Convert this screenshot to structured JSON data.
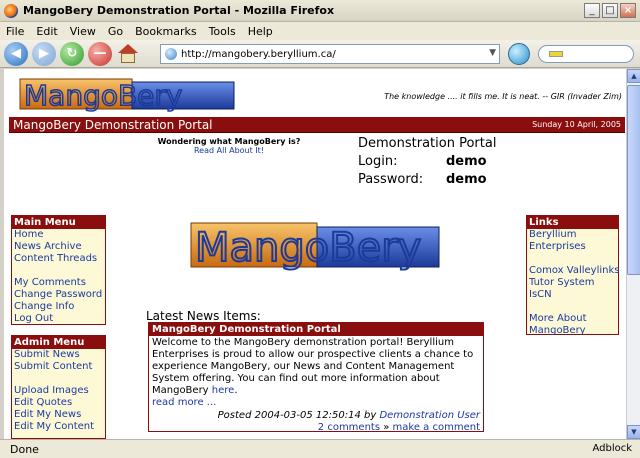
{
  "window": {
    "title": "MangoBery Demonstration Portal - Mozilla Firefox",
    "buttons": [
      "_",
      "□",
      "×"
    ]
  },
  "menu": [
    "File",
    "Edit",
    "View",
    "Go",
    "Bookmarks",
    "Tools",
    "Help"
  ],
  "navigation": {
    "url": "http://mangobery.beryllium.ca/"
  },
  "status": {
    "left": "Done",
    "right": "Adblock"
  },
  "page": {
    "logo_text": "MangoBery",
    "quote": "The knowledge .... it fills me. It is neat. -- GIR (Invader Zim)",
    "banner_title": "MangoBery Demonstration Portal",
    "banner_date": "Sunday 10 April, 2005",
    "wonder": {
      "question": "Wondering what MangoBery is?",
      "link": "Read All About It!"
    },
    "demo": {
      "title": "Demonstration Portal",
      "login_label": "Login:",
      "login_value": "demo",
      "password_label": "Password:",
      "password_value": "demo"
    },
    "main_menu": {
      "heading": "Main Menu",
      "group1": [
        "Home",
        "News Archive",
        "Content Threads"
      ],
      "group2": [
        "My Comments",
        "Change Password",
        "Change Info",
        "Log Out"
      ]
    },
    "admin_menu": {
      "heading": "Admin Menu",
      "group1": [
        "Submit News",
        "Submit Content"
      ],
      "group2": [
        "Upload Images",
        "Edit Quotes",
        "Edit My News",
        "Edit My Content"
      ]
    },
    "links": {
      "heading": "Links",
      "group1": [
        "Beryllium",
        "Enterprises"
      ],
      "group2": [
        "Comox Valleylinks",
        "Tutor System",
        "IsCN"
      ],
      "group3": [
        "More About",
        "MangoBery"
      ]
    },
    "news": {
      "heading": "Latest News Items:",
      "title": "MangoBery Demonstration Portal",
      "body": "Welcome to the MangoBery demonstration portal! Beryllium Enterprises is proud to allow our prospective clients a chance to experience MangoBery, our News and Content Management System offering. You can find out more information about MangoBery",
      "here_link": "here",
      "read_more": "read more ...",
      "posted": "Posted 2004-03-05 12:50:14 by",
      "author": "Demonstration User",
      "comments": "2 comments",
      "make_comment": "make a comment"
    }
  }
}
